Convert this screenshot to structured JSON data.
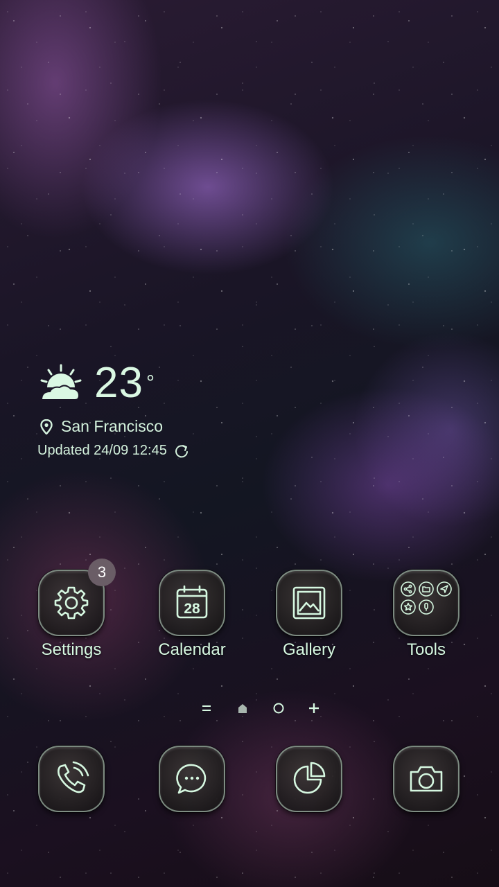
{
  "weather": {
    "temperature": "23",
    "degree_symbol": "°",
    "location": "San Francisco",
    "updated": "Updated 24/09 12:45",
    "icon": "partly-cloudy-sun-icon"
  },
  "apps": [
    {
      "label": "Settings",
      "icon": "gear-icon",
      "badge": "3"
    },
    {
      "label": "Calendar",
      "icon": "calendar-icon",
      "calendar_day": "28"
    },
    {
      "label": "Gallery",
      "icon": "gallery-icon"
    },
    {
      "label": "Tools",
      "icon": "folder-icon"
    }
  ],
  "pager": {
    "items": [
      "menu-indicator",
      "home-indicator",
      "page-dot",
      "add-page"
    ]
  },
  "dock": [
    {
      "icon": "phone-icon"
    },
    {
      "icon": "messages-icon"
    },
    {
      "icon": "pie-chart-icon"
    },
    {
      "icon": "camera-icon"
    }
  ],
  "colors": {
    "accent": "#d6f8e1",
    "badge": "#6a5d66"
  }
}
